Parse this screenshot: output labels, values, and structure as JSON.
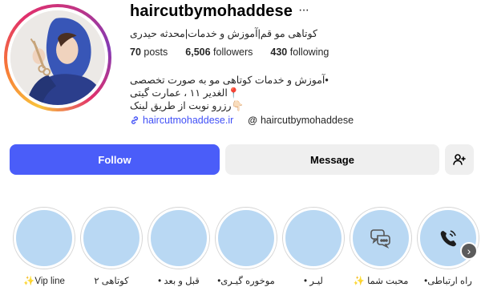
{
  "profile": {
    "username": "haircutbymohaddese",
    "more_glyph": "···",
    "full_name": "کوتاهی مو قم|آموزش و خدمات|محدثه حیدری",
    "stats": {
      "posts": "70",
      "posts_label": "posts",
      "followers": "6,506",
      "followers_label": "followers",
      "following": "430",
      "following_label": "following"
    },
    "bio": [
      "•آموزش و خدمات کوتاهی مو به صورت تخصصی",
      "📍الغدیر ۱۱ ، عمارت گیتی",
      "👇🏻رزرو نوبت از طریق لینک"
    ],
    "link_text": "haircutmohaddese.ir",
    "threads_text": "haircutbymohaddese"
  },
  "actions": {
    "follow": "Follow",
    "message": "Message"
  },
  "highlights": [
    {
      "label": "راه ارتباطی•",
      "icon": "phone-icon"
    },
    {
      "label": "محبت شما ✨",
      "icon": "chat-bubble-icon"
    },
    {
      "label": "لیـر •",
      "icon": ""
    },
    {
      "label": "موخوره گیـری•",
      "icon": ""
    },
    {
      "label": "قبل و بعد •",
      "icon": ""
    },
    {
      "label": "کوتاهی ۲",
      "icon": ""
    },
    {
      "label": "✨Vip line",
      "icon": ""
    }
  ],
  "colors": {
    "follow_bg": "#4a5df9",
    "highlight_cover": "#b9d8f3",
    "link": "#4150f7"
  }
}
